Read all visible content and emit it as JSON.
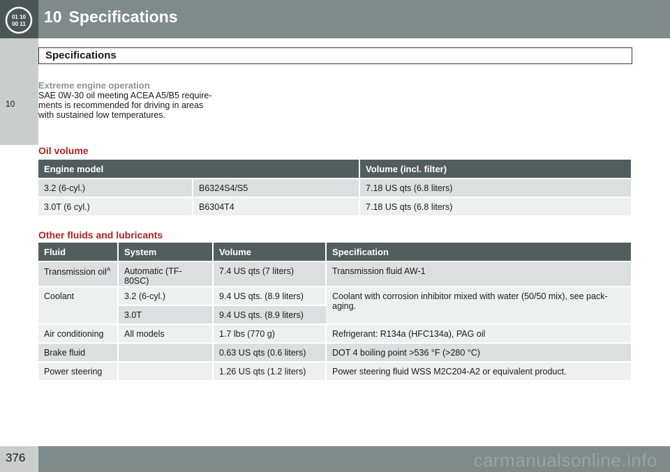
{
  "header": {
    "chapter_number": "10",
    "chapter_title": "Specifications",
    "icon": "odometer-icon",
    "icon_text_top": "01 10",
    "icon_text_bottom": "00 11"
  },
  "side_tab": {
    "label": "10"
  },
  "section": {
    "title": "Specifications"
  },
  "intro": {
    "heading": "Extreme engine operation",
    "lines": [
      "SAE 0W-30 oil meeting ACEA A5/B5 require-",
      "ments is recommended for driving in areas",
      "with sustained low temperatures."
    ]
  },
  "oil_volume": {
    "heading": "Oil volume",
    "columns": [
      "Engine model",
      "Volume (incl. filter)"
    ],
    "rows": [
      [
        "3.2 (6-cyl.)",
        "B6324S4/S5",
        "7.18 US qts (6.8 liters)"
      ],
      [
        "3.0T (6 cyl.)",
        "B6304T4",
        "7.18 US qts (6.8 liters)"
      ]
    ]
  },
  "fluids": {
    "heading": "Other fluids and lubricants",
    "columns": [
      "Fluid",
      "System",
      "Volume",
      "Specification"
    ],
    "rows": [
      {
        "fluid": "Transmission oil",
        "sup": "A",
        "system": "Automatic (TF-80SC)",
        "volume": "7.4 US qts (7 liters)",
        "spec": "Transmission fluid AW-1"
      },
      {
        "fluid": "Coolant",
        "system": "3.2 (6-cyl.)",
        "volume": "9.4 US qts. (8.9 liters)",
        "spec": "Coolant with corrosion inhibitor mixed with water (50/50 mix), see pack-aging."
      },
      {
        "system": "3.0T",
        "volume": "9.4 US qts. (8.9 liters)"
      },
      {
        "fluid": "Air conditioning",
        "system": "All models",
        "volume": "1.7 lbs (770 g)",
        "spec": "Refrigerant: R134a (HFC134a), PAG oil"
      },
      {
        "fluid": "Brake fluid",
        "system": "",
        "volume": "0.63 US qts (0.6 liters)",
        "spec": "DOT 4 boiling point >536 °F (>280 °C)"
      },
      {
        "fluid": "Power steering",
        "system": "",
        "volume": "1.26 US qts (1.2 liters)",
        "spec": "Power steering fluid WSS M2C204-A2 or equivalent product."
      }
    ]
  },
  "footer": {
    "page_number": "376",
    "watermark": "carmanualsonline.info"
  }
}
